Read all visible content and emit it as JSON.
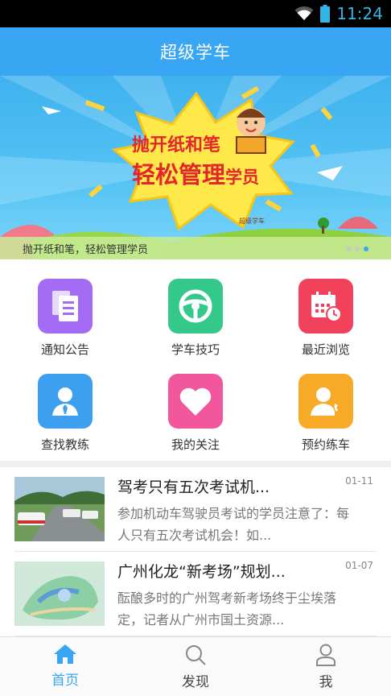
{
  "status_bar": {
    "time": "11:24"
  },
  "app_bar": {
    "title": "超级学车"
  },
  "banner": {
    "headline_line1": "抛开纸和笔",
    "headline_line2_main": "轻松管理",
    "headline_line2_small": "学员",
    "badge": "超级学车",
    "caption": "抛开纸和笔，轻松管理学员",
    "page_index": 3,
    "page_count": 3
  },
  "grid": [
    {
      "label": "通知公告",
      "icon": "document-icon",
      "color": "#a46bf5"
    },
    {
      "label": "学车技巧",
      "icon": "steering-wheel-icon",
      "color": "#34c98b"
    },
    {
      "label": "最近浏览",
      "icon": "calendar-clock-icon",
      "color": "#f2415a"
    },
    {
      "label": "查找教练",
      "icon": "person-tie-icon",
      "color": "#3d9ff0"
    },
    {
      "label": "我的关注",
      "icon": "heart-icon",
      "color": "#f2569c"
    },
    {
      "label": "预约练车",
      "icon": "person-phone-icon",
      "color": "#f7a928"
    }
  ],
  "news": [
    {
      "title": "驾考只有五次考试机...",
      "date": "01-11",
      "summary": "参加机动车驾驶员考试的学员注意了：每人只有五次考试机会！如..."
    },
    {
      "title": "广州化龙“新考场”规划...",
      "date": "01-07",
      "summary": "酝酿多时的广州驾考新考场终于尘埃落定，记者从广州市国土资源..."
    }
  ],
  "bottom_nav": [
    {
      "label": "首页",
      "icon": "home-icon",
      "active": true
    },
    {
      "label": "发现",
      "icon": "search-icon",
      "active": false
    },
    {
      "label": "我",
      "icon": "user-icon",
      "active": false
    }
  ],
  "colors": {
    "primary": "#39a6f3",
    "headline_red": "#e2262a"
  }
}
